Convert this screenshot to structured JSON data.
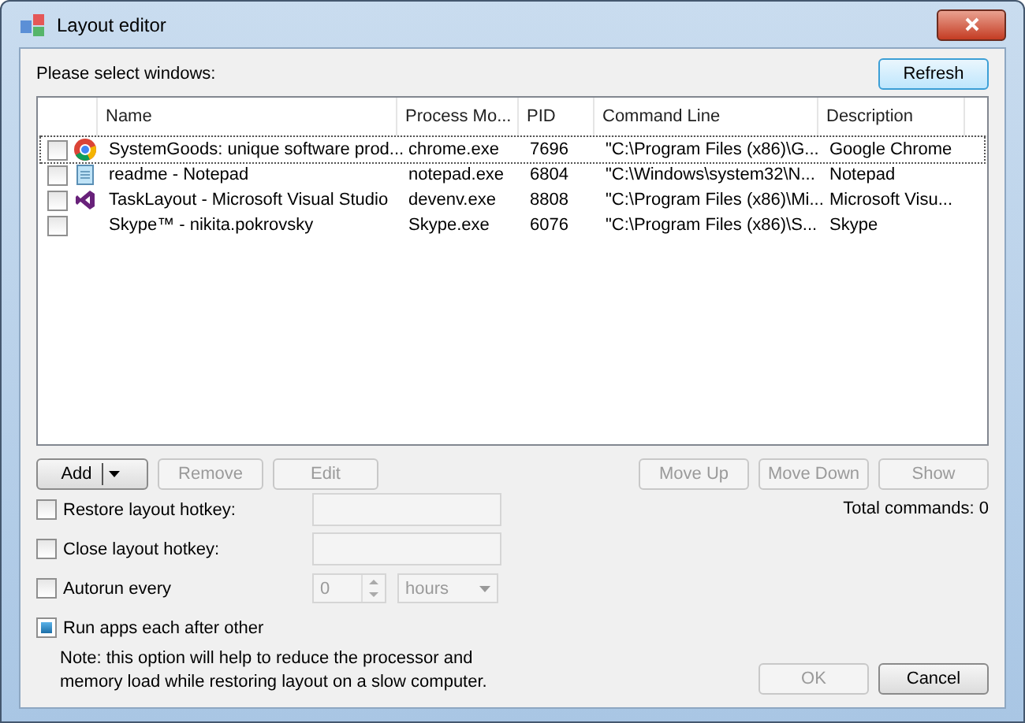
{
  "window": {
    "title": "Layout editor"
  },
  "prompt": "Please select windows:",
  "refresh": {
    "label": "Refresh",
    "disabled": false
  },
  "table": {
    "columns": [
      "Name",
      "Process Mo...",
      "PID",
      "Command Line",
      "Description"
    ],
    "rows": [
      {
        "checked": false,
        "selected": true,
        "kind": "chrome",
        "cells": [
          "SystemGoods: unique software prod...",
          "chrome.exe",
          "7696",
          "\"C:\\Program Files (x86)\\G...",
          "Google Chrome"
        ]
      },
      {
        "checked": false,
        "selected": false,
        "kind": "notepad",
        "cells": [
          "readme - Notepad",
          "notepad.exe",
          "6804",
          "\"C:\\Windows\\system32\\N...",
          "Notepad"
        ]
      },
      {
        "checked": false,
        "selected": false,
        "kind": "vs",
        "cells": [
          "TaskLayout - Microsoft Visual Studio",
          "devenv.exe",
          "8808",
          "\"C:\\Program Files (x86)\\Mi...",
          "Microsoft Visu..."
        ]
      },
      {
        "checked": false,
        "selected": false,
        "kind": "none",
        "cells": [
          "Skype™ - nikita.pokrovsky",
          "Skype.exe",
          "6076",
          "\"C:\\Program Files (x86)\\S...",
          "Skype"
        ]
      }
    ]
  },
  "left_buttons": [
    {
      "label": "Add",
      "disabled": false,
      "dropdown": true
    },
    {
      "label": "Remove",
      "disabled": true,
      "dropdown": false
    },
    {
      "label": "Edit",
      "disabled": true,
      "dropdown": false
    }
  ],
  "right_buttons": [
    {
      "label": "Move Up",
      "disabled": true
    },
    {
      "label": "Move Down",
      "disabled": true
    },
    {
      "label": "Show",
      "disabled": true
    }
  ],
  "total": "Total commands: 0",
  "options": [
    {
      "kind": "hotkey",
      "label": "Restore layout hotkey:",
      "checked": false
    },
    {
      "kind": "hotkey",
      "label": "Close layout hotkey:",
      "checked": false
    },
    {
      "kind": "autorun",
      "label": "Autorun every",
      "checked": false,
      "value": "0",
      "unit": "hours"
    },
    {
      "kind": "plain",
      "label": "Run apps each after other",
      "checked": true,
      "note": "Note: this option will help to reduce the processor and memory load while restoring layout on a slow computer."
    }
  ],
  "footer": [
    {
      "label": "OK",
      "disabled": true
    },
    {
      "label": "Cancel",
      "disabled": false
    }
  ]
}
